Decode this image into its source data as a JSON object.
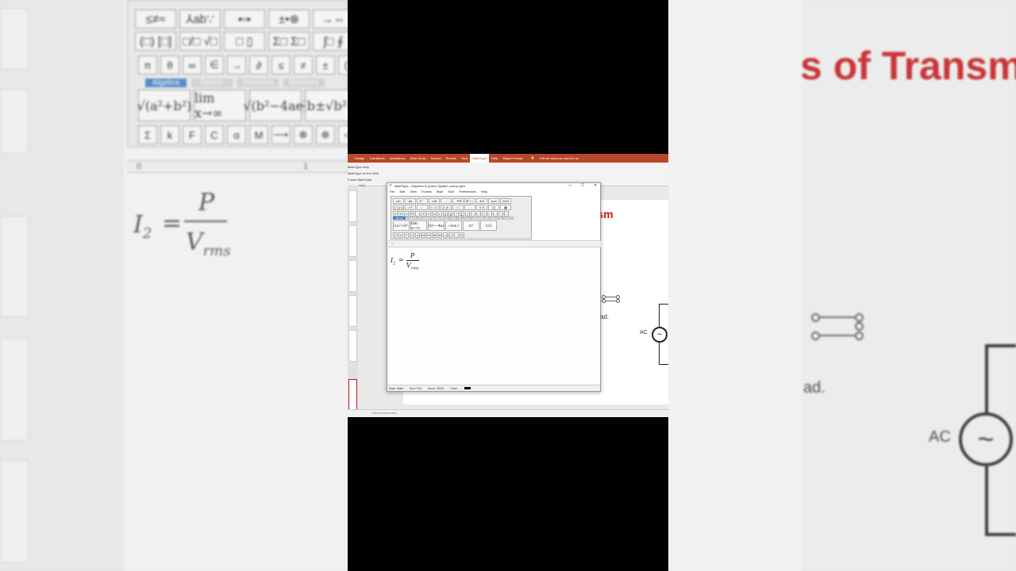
{
  "ribbon": {
    "tabs": [
      "Design",
      "Transitions",
      "Animations",
      "Slide Show",
      "Record",
      "Review",
      "View",
      "MathType",
      "Help",
      "Shape Format"
    ],
    "active_tab": "MathType",
    "tell_me": "Tell me what you want to do",
    "mathtype_items": [
      "MathType Help",
      "MathType on the Web",
      "Future MathType"
    ],
    "group_label": "Help"
  },
  "slide": {
    "title_fragment": "s of Transm",
    "text_fragment": "ad.",
    "ac_label": "AC",
    "source_symbol": "~"
  },
  "notes": {
    "placeholder": "Click to add notes"
  },
  "mathtype": {
    "window_title": "MathType - Equation in power System course.pptx",
    "controls": {
      "minimize": "—",
      "maximize": "☐",
      "close": "✕"
    },
    "menu": [
      "File",
      "Edit",
      "View",
      "Format",
      "Style",
      "Size",
      "Preferences",
      "Help"
    ],
    "palette_row1": [
      "≤≠≈",
      "∴ab∵",
      "∂∵∷",
      "±•⊗",
      "→⇔↓",
      "∴∀∃",
      "∉∩⊂",
      "∂∞ℓ",
      "λωθ",
      "ΛΩΘ"
    ],
    "palette_row2": [
      "(□) [□]",
      "□/√□",
      "□ ‾",
      "Σ□ Σ□",
      "∫□ ∮□",
      "□ □",
      "→ ←",
      "Û Ů",
      "▯▯",
      "▦"
    ],
    "palette_row3": [
      "π",
      "θ",
      "∞",
      "∈",
      "→",
      "∂",
      "≤",
      "≠",
      "±",
      "()",
      "[]",
      "√",
      "∑",
      "∫",
      "□",
      "□",
      "√",
      "□",
      "□",
      "□",
      "□"
    ],
    "palette_tabs": [
      "Algebra",
      "Derivs",
      "Statistics",
      "Matrices",
      "Sets",
      "Trig",
      "Geometry",
      "Tab 8",
      "Tab 9"
    ],
    "palette_big": [
      "√(a²+b²)",
      "lim x→∞",
      "√(b²−4ac)",
      "−b±√",
      "n!",
      "1/2"
    ],
    "palette_row4": [
      "Σ",
      "k",
      "F",
      "C",
      "α",
      "M",
      "⟶",
      "⊗",
      "⊕",
      "◁",
      "▷",
      "∴",
      "Ω"
    ],
    "equation": {
      "lhs_symbol": "I",
      "lhs_sub": "2",
      "equals": "=",
      "numerator": "P",
      "denominator_symbol": "V",
      "denominator_sub": "rms"
    },
    "status": {
      "style": "Style: Math",
      "size": "Size: Full",
      "zoom": "Zoom: 200%",
      "color_label": "Color:"
    }
  },
  "background": {
    "title_fragment": "s of Transm",
    "text_fragment": "ad.",
    "ac_label": "AC",
    "ruler_labels": [
      "0",
      "1"
    ],
    "palette_row1": [
      "≤≠≈",
      "⅄ab∵",
      "▪▫▪",
      "±•⊗",
      "→⇔"
    ],
    "palette_row2": [
      "(□) [□]",
      "□/□ √□",
      "□ ▯",
      "Σ□ Σ□",
      "∫□ ∮"
    ],
    "palette_row3": [
      "π",
      "θ",
      "∞",
      "∈",
      "→",
      "∂",
      "≤",
      "≠",
      "±",
      "()"
    ],
    "palette_tabs": [
      "Algebra",
      "Derivs",
      "Statistics",
      "Matrices"
    ],
    "palette_big": [
      "√(a²+b²)",
      "lim x→∞",
      "√(b²−4ac)",
      "−b±√b²−4"
    ],
    "palette_row4": [
      "Σ",
      "k",
      "F",
      "C",
      "α",
      "M",
      "⟶",
      "⊗",
      "⊕",
      "◁"
    ],
    "equation": {
      "lhs_symbol": "I",
      "lhs_sub": "2",
      "equals": "=",
      "numerator": "P",
      "denominator_symbol": "V",
      "denominator_sub": "rms"
    }
  },
  "colors": {
    "ribbon": "#b7472a",
    "title_red": "#c6161b",
    "tab_blue": "#3b7fc4",
    "letterbox": "#000000"
  }
}
